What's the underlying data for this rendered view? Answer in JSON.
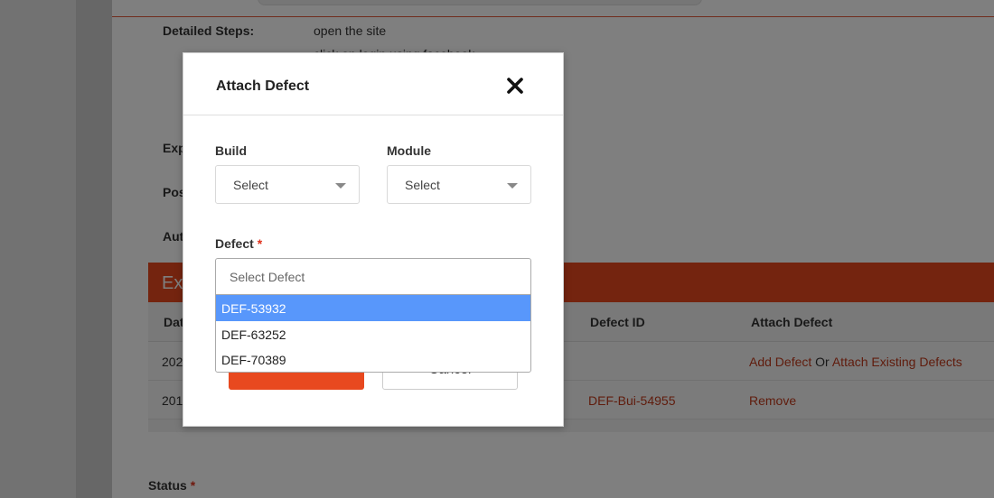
{
  "background": {
    "detailed_steps_label": "Detailed Steps:",
    "steps": [
      "open the site",
      "click on login using facebook"
    ],
    "expected_label_partial": "Exp",
    "post_label_partial": "Pos",
    "auto_label_partial": "Aut",
    "execution_bar_partial": "Exe",
    "table": {
      "headers": {
        "date_partial": "Dat",
        "defect_id": "Defect ID",
        "attach_defect": "Attach Defect"
      },
      "rows": [
        {
          "date_partial": "202",
          "defect_id": "",
          "add_defect": "Add Defect",
          "or": "Or",
          "attach_existing": "Attach Existing Defects"
        },
        {
          "date_partial": "201",
          "defect_id": "DEF-Bui-54955",
          "remove": "Remove"
        }
      ]
    },
    "status_label": "Status",
    "status_required": "*"
  },
  "modal": {
    "title": "Attach Defect",
    "build": {
      "label": "Build",
      "value": "Select"
    },
    "module": {
      "label": "Module",
      "value": "Select"
    },
    "defect": {
      "label": "Defect",
      "required": "*",
      "placeholder": "Select Defect",
      "options": [
        {
          "label": "DEF-53932",
          "highlighted": true
        },
        {
          "label": "DEF-63252",
          "highlighted": false
        },
        {
          "label": "DEF-70389",
          "highlighted": false
        }
      ]
    },
    "attach_label": "Attach",
    "cancel_label": "Cancel"
  },
  "colors": {
    "accent": "#e8491f",
    "link": "#c0391b",
    "highlight": "#5897fb",
    "required": "#e0311c"
  },
  "icons": {
    "close": "close-icon",
    "caret": "chevron-down-icon"
  }
}
